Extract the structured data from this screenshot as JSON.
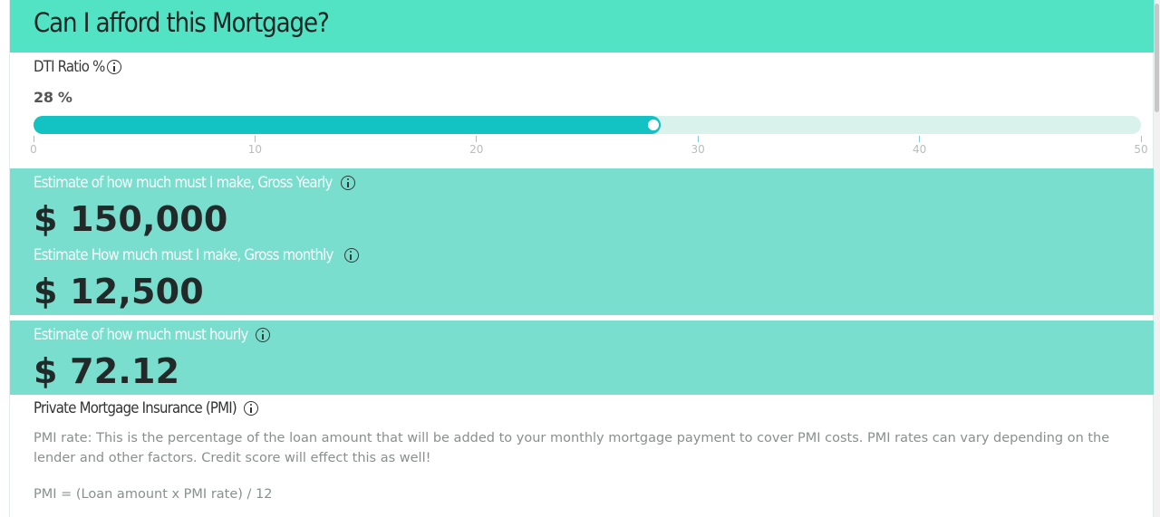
{
  "header": {
    "title": "Can I afford this Mortgage?",
    "background": "#51e3c3"
  },
  "dti": {
    "label": "DTI Ratio %",
    "value_display": "28 %",
    "value": 28,
    "min": 0,
    "max": 50,
    "ticks": [
      "0",
      "10",
      "20",
      "30",
      "40",
      "50"
    ],
    "fill_color": "#13c2c3",
    "track_color": "#d9f2ec"
  },
  "yearly": {
    "label": "Estimate of how much must I make, Gross Yearly",
    "value": "$ 150,000"
  },
  "monthly": {
    "label": "Estimate How much must I make, Gross monthly",
    "value": "$ 12,500"
  },
  "hourly": {
    "label": "Estimate of how much must hourly",
    "value": "$ 72.12"
  },
  "panel_color": "#7adecf",
  "pmi": {
    "label": "Private Mortgage Insurance (PMI)",
    "description": "PMI rate: This is the percentage of the loan amount that will be added to your monthly mortgage payment to cover PMI costs. PMI rates can vary depending on the lender and other factors. Credit score will effect this as well!",
    "formula": "PMI = (Loan amount x PMI rate) / 12"
  }
}
